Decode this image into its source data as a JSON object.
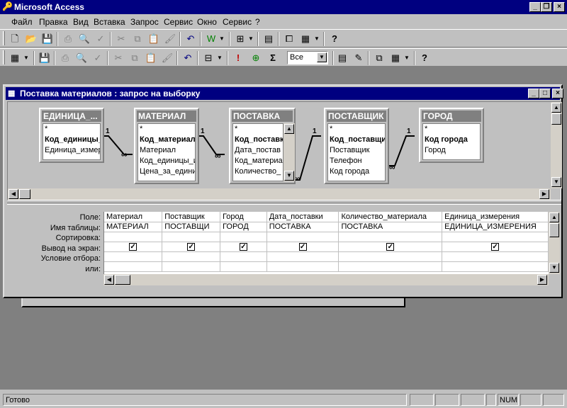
{
  "app": {
    "title": "Microsoft Access"
  },
  "menu": [
    "Файл",
    "Правка",
    "Вид",
    "Вставка",
    "Запрос",
    "Сервис",
    "Окно",
    "Сервис",
    "?"
  ],
  "toolbar": {
    "combo_value": "Все"
  },
  "query_window": {
    "title": "Поставка материалов : запрос на выборку"
  },
  "tables": [
    {
      "name": "ЕДИНИЦА_...",
      "fields": [
        {
          "text": "*",
          "key": false
        },
        {
          "text": "Код_единицы_и",
          "key": true
        },
        {
          "text": "Единица_измере",
          "key": false
        }
      ]
    },
    {
      "name": "МАТЕРИАЛ",
      "fields": [
        {
          "text": "*",
          "key": false
        },
        {
          "text": "Код_материала",
          "key": true
        },
        {
          "text": "Материал",
          "key": false
        },
        {
          "text": "Код_единицы_и",
          "key": false
        },
        {
          "text": "Цена_за_единиц",
          "key": false
        }
      ]
    },
    {
      "name": "ПОСТАВКА",
      "fields": [
        {
          "text": "*",
          "key": false
        },
        {
          "text": "Код_поставк",
          "key": true
        },
        {
          "text": "Дата_постав",
          "key": false
        },
        {
          "text": "Код_материа",
          "key": false
        },
        {
          "text": "Количество_",
          "key": false
        }
      ]
    },
    {
      "name": "ПОСТАВЩИК",
      "fields": [
        {
          "text": "*",
          "key": false
        },
        {
          "text": "Код_поставщик",
          "key": true
        },
        {
          "text": "Поставщик",
          "key": false
        },
        {
          "text": "Телефон",
          "key": false
        },
        {
          "text": "Код города",
          "key": false
        }
      ]
    },
    {
      "name": "ГОРОД",
      "fields": [
        {
          "text": "*",
          "key": false
        },
        {
          "text": "Код города",
          "key": true
        },
        {
          "text": "Город",
          "key": false
        }
      ]
    }
  ],
  "relations": {
    "one": "1",
    "many": "∞"
  },
  "grid": {
    "row_labels": [
      "Поле:",
      "Имя таблицы:",
      "Сортировка:",
      "Вывод на экран:",
      "Условие отбора:",
      "или:"
    ],
    "columns": [
      {
        "field": "Материал",
        "table": "МАТЕРИАЛ",
        "show": true
      },
      {
        "field": "Поставщик",
        "table": "ПОСТАВЩИ",
        "show": true
      },
      {
        "field": "Город",
        "table": "ГОРОД",
        "show": true
      },
      {
        "field": "Дата_поставки",
        "table": "ПОСТАВКА",
        "show": true
      },
      {
        "field": "Количество_материала",
        "table": "ПОСТАВКА",
        "show": true
      },
      {
        "field": "Единица_измерения",
        "table": "ЕДИНИЦА_ИЗМЕРЕНИЯ",
        "show": true
      }
    ]
  },
  "status": {
    "text": "Готово",
    "num": "NUM"
  }
}
